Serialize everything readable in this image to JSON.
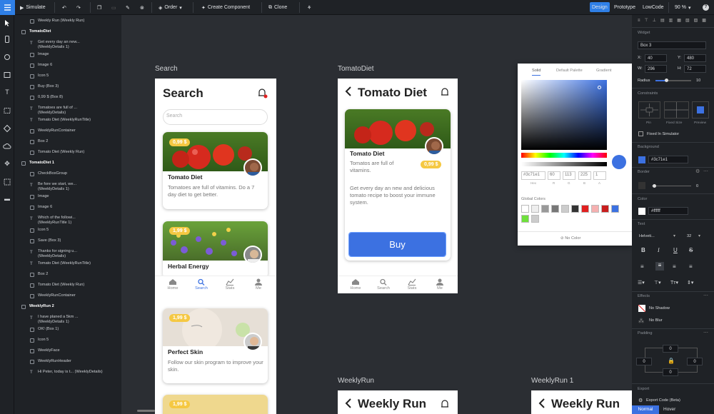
{
  "toolbar": {
    "simulate": "Simulate",
    "order": "Order",
    "create_component": "Create Component",
    "clone": "Clone",
    "design": "Design",
    "prototype": "Prototype",
    "lowcode": "LowCode",
    "zoom": "90 %",
    "help": "?"
  },
  "layers": {
    "items": [
      {
        "label": "Weekly Run (Weekly Run)",
        "kind": "box",
        "indent": 1
      },
      {
        "label": "TomatoDiet",
        "kind": "group",
        "indent": 0
      },
      {
        "label": "Get every day an new...\n(WeeklyDetails 1)",
        "kind": "text",
        "indent": 1
      },
      {
        "label": "Image",
        "kind": "box",
        "indent": 1
      },
      {
        "label": "Image 6",
        "kind": "box",
        "indent": 1
      },
      {
        "label": "Icon 5",
        "kind": "box",
        "indent": 1
      },
      {
        "label": "Buy (Box 3)",
        "kind": "box",
        "indent": 1
      },
      {
        "label": "0,99 $ (Box 8)",
        "kind": "box",
        "indent": 1
      },
      {
        "label": "Tomatoes are full of ...\n(WeeklyDetails)",
        "kind": "text",
        "indent": 1
      },
      {
        "label": "Tomato Diet (WeeklyRunTitle)",
        "kind": "text",
        "indent": 1
      },
      {
        "label": "WeeklyRunContainer",
        "kind": "box",
        "indent": 1
      },
      {
        "label": "Box 2",
        "kind": "box",
        "indent": 1
      },
      {
        "label": "Tomato Diet (Weekly Run)",
        "kind": "box",
        "indent": 1
      },
      {
        "label": "TomatoDiet 1",
        "kind": "group",
        "indent": 0
      },
      {
        "label": "CheckBoxGroup",
        "kind": "box",
        "indent": 1
      },
      {
        "label": "Be fore we start, we...\n(WeeklyDetails 1)",
        "kind": "text",
        "indent": 1
      },
      {
        "label": "Image",
        "kind": "box",
        "indent": 1
      },
      {
        "label": "Image 6",
        "kind": "box",
        "indent": 1
      },
      {
        "label": "Which of the followi...\n(WeeklyRunTitle 1)",
        "kind": "text",
        "indent": 1
      },
      {
        "label": "Icon 5",
        "kind": "box",
        "indent": 1
      },
      {
        "label": "Save (Box 3)",
        "kind": "box",
        "indent": 1
      },
      {
        "label": "Thanks for signing u...\n(WeeklyDetails)",
        "kind": "text",
        "indent": 1
      },
      {
        "label": "Tomato Diet (WeeklyRunTitle)",
        "kind": "text",
        "indent": 1
      },
      {
        "label": "Box 2",
        "kind": "box",
        "indent": 1
      },
      {
        "label": "Tomato Diet (Weekly Run)",
        "kind": "box",
        "indent": 1
      },
      {
        "label": "WeeklyRunContainer",
        "kind": "box",
        "indent": 1
      },
      {
        "label": "WeeklyRun 2",
        "kind": "group",
        "indent": 0
      },
      {
        "label": "I have planed a 5km ...\n(WeeklyDetails 1)",
        "kind": "text",
        "indent": 1
      },
      {
        "label": "OK! (Box 1)",
        "kind": "box",
        "indent": 1
      },
      {
        "label": "Icon 5",
        "kind": "box",
        "indent": 1
      },
      {
        "label": "WeeklyFace",
        "kind": "box",
        "indent": 1
      },
      {
        "label": "WeeklyRunHeader",
        "kind": "box",
        "indent": 1
      },
      {
        "label": "Hi Peter, today is t... (WeeklyDetails)",
        "kind": "text",
        "indent": 1
      }
    ]
  },
  "frames": {
    "search_label": "Search",
    "tomato_label": "TomatoDiet",
    "weekly_label": "WeeklyRun",
    "weekly1_label": "WeeklyRun 1"
  },
  "search_screen": {
    "title": "Search",
    "placeholder": "Search",
    "cards": [
      {
        "price": "0,99 $",
        "title": "Tomato Diet",
        "desc": "Tomatoes are full of vitamins. Do a 7 day diet to get better."
      },
      {
        "price": "1,99 $",
        "title": "Herbal Energy",
        "desc": ""
      },
      {
        "price": "1,99 $",
        "title": "Perfect Skin",
        "desc": "Follow our skin program to improve your skin."
      },
      {
        "price": "1,99 $",
        "title": "",
        "desc": ""
      }
    ],
    "tabs": [
      "Home",
      "Search",
      "Stats",
      "Me"
    ]
  },
  "tomato_screen": {
    "title": "Tomato Diet",
    "card_title": "Tomato Diet",
    "card_sub": "Tomatos are full of vitamins.",
    "price": "0,99 $",
    "body": "Get every day an new and delicious tomato recipe to boost your immune system.",
    "buy": "Buy",
    "tabs": [
      "Home",
      "Search",
      "Stats",
      "Me"
    ]
  },
  "weekly_screen": {
    "title": "Weekly Run"
  },
  "weekly1_screen": {
    "title": "Weekly Run"
  },
  "color_picker": {
    "tabs": [
      "Solid",
      "Default Palette",
      "Gradient"
    ],
    "hex": "#3c71e1",
    "h": "60",
    "r": "113",
    "g": "225",
    "b": "1",
    "labels": [
      "Hex",
      "R",
      "G",
      "B",
      "A"
    ],
    "global_colors": "Global Colors",
    "no_color": "No Color",
    "swatches": [
      "#ffffff",
      "#eeeeee",
      "#999999",
      "#777777",
      "#cccccc",
      "#333333",
      "#e02020",
      "#f5b0b0",
      "#c81e1e",
      "#3c71e1",
      "#6fe03c",
      "#cccccc"
    ]
  },
  "inspector": {
    "widget": "Widget",
    "name": "Box 3",
    "x": "40",
    "y": "480",
    "w": "296",
    "h": "72",
    "x_label": "X:",
    "y_label": "Y:",
    "w_label": "W:",
    "h_label": "H:",
    "radius_label": "Radius",
    "radius": "10",
    "constraints": "Constraints",
    "pin": "Pin",
    "fixed_size": "Fixed Size",
    "preview": "Preview",
    "fixed_in_sim": "Fixed In Simulator",
    "background": "Background",
    "bg_hex": "#3c71e1",
    "border": "Border",
    "border_val": "0",
    "color": "Color",
    "color_hex": "#ffffff",
    "text": "Text",
    "font": "Helveti...",
    "font_size": "32",
    "effects": "Effects",
    "no_shadow": "No Shadow",
    "no_blur": "No Blur",
    "padding": "Padding",
    "pad_top": "0",
    "pad_left": "0",
    "pad_right": "0",
    "pad_bottom": "0",
    "export": "Export",
    "export_code": "Export Code (Beta)",
    "normal": "Normal",
    "hover": "Hover",
    "accent": "#3c71e1"
  }
}
